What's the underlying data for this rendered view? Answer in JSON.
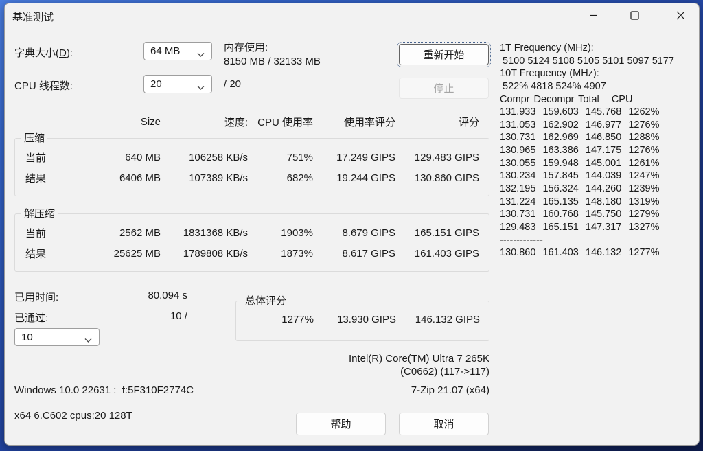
{
  "window": {
    "title": "基准测试"
  },
  "icons": {
    "minimize": "horizontal-line",
    "maximize": "square-outline",
    "close": "x-cross",
    "chevron_down": "v-chevron"
  },
  "form": {
    "dict_label_pre": "字典大小(",
    "dict_label_key": "D",
    "dict_label_post": "):",
    "dict_value": "64 MB",
    "memory_label": "内存使用:",
    "memory_value": "8150 MB / 32133 MB",
    "threads_label": "CPU 线程数:",
    "threads_value": "20",
    "threads_suffix": "/ 20",
    "restart_button": "重新开始",
    "stop_button": "停止"
  },
  "log": {
    "lines": [
      "1T Frequency (MHz):",
      " 5100 5124 5108 5105 5101 5097 5177",
      "10T Frequency (MHz):",
      " 522% 4818 524% 4907",
      "Compr Decompr Total   CPU",
      "131.933 159.603 145.768 1262%",
      "131.053 162.902 146.977 1276%",
      "130.731 162.969 146.850 1288%",
      "130.965 163.386 147.175 1276%",
      "130.055 159.948 145.001 1261%",
      "130.234 157.845 144.039 1247%",
      "132.195 156.324 144.260 1239%",
      "131.224 165.135 148.180 1319%",
      "130.731 160.768 145.750 1279%",
      "129.483 165.151 147.317 1327%",
      "-------------",
      "130.860 161.403 146.132 1277%"
    ]
  },
  "table": {
    "headers": [
      "Size",
      "速度:",
      "CPU 使用率",
      "使用率评分",
      "评分"
    ],
    "compression": {
      "group_label": "压缩",
      "rows": [
        {
          "label": "当前",
          "size": "640 MB",
          "speed": "106258 KB/s",
          "cpu": "751%",
          "usage_rating": "17.249 GIPS",
          "rating": "129.483 GIPS"
        },
        {
          "label": "结果",
          "size": "6406 MB",
          "speed": "107389 KB/s",
          "cpu": "682%",
          "usage_rating": "19.244 GIPS",
          "rating": "130.860 GIPS"
        }
      ]
    },
    "decompression": {
      "group_label": "解压缩",
      "rows": [
        {
          "label": "当前",
          "size": "2562 MB",
          "speed": "1831368 KB/s",
          "cpu": "1903%",
          "usage_rating": "8.679 GIPS",
          "rating": "165.151 GIPS"
        },
        {
          "label": "结果",
          "size": "25625 MB",
          "speed": "1789808 KB/s",
          "cpu": "1873%",
          "usage_rating": "8.617 GIPS",
          "rating": "161.403 GIPS"
        }
      ]
    }
  },
  "footer": {
    "elapsed_label": "已用时间:",
    "elapsed_value": "80.094 s",
    "passes_label": "已通过:",
    "passes_value": "10 /",
    "passes_dropdown": "10",
    "total_group_label": "总体评分",
    "total_cpu": "1277%",
    "total_usage_rating": "13.930 GIPS",
    "total_rating": "146.132 GIPS",
    "cpu_name": "Intel(R) Core(TM) Ultra 7 265K",
    "cpu_detail": "(C0662) (117->117)",
    "os_info": "Windows 10.0 22631 :  f:5F310F2774C",
    "app_version": "7-Zip 21.07 (x64)",
    "arch_info": "x64 6.C602 cpus:20 128T",
    "help_button": "帮助",
    "cancel_button": "取消"
  }
}
